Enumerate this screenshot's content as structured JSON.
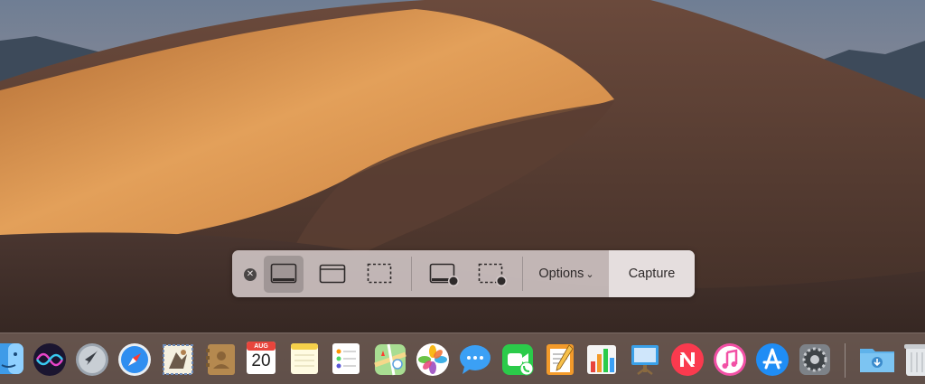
{
  "toolbar": {
    "close_symbol": "✕",
    "options_label": "Options",
    "options_chevron": "⌄",
    "capture_label": "Capture",
    "buttons": [
      {
        "icon": "capture-entire-screen-icon",
        "selected": true
      },
      {
        "icon": "capture-window-icon",
        "selected": false
      },
      {
        "icon": "capture-selection-icon",
        "selected": false
      },
      {
        "icon": "record-entire-screen-icon",
        "selected": false
      },
      {
        "icon": "record-selection-icon",
        "selected": false
      }
    ]
  },
  "dock": {
    "apps": [
      "finder-icon",
      "siri-icon",
      "launchpad-icon",
      "safari-icon",
      "mail-icon",
      "contacts-icon",
      "calendar-icon",
      "notes-icon",
      "reminders-icon",
      "maps-icon",
      "photos-icon",
      "messages-icon",
      "facetime-icon",
      "pages-icon",
      "numbers-icon",
      "keynote-icon",
      "news-icon",
      "itunes-icon",
      "app-store-icon",
      "system-preferences-icon",
      "downloads-folder-icon",
      "trash-icon"
    ],
    "calendar": {
      "month": "AUG",
      "day": "20"
    }
  },
  "colors": {
    "toolbar_bg": "#d6cccc",
    "capture_bg": "#e8e2e2",
    "selected_bg": "#787070",
    "dune_light": "#d9924a",
    "dune_dark": "#3b2a22"
  }
}
